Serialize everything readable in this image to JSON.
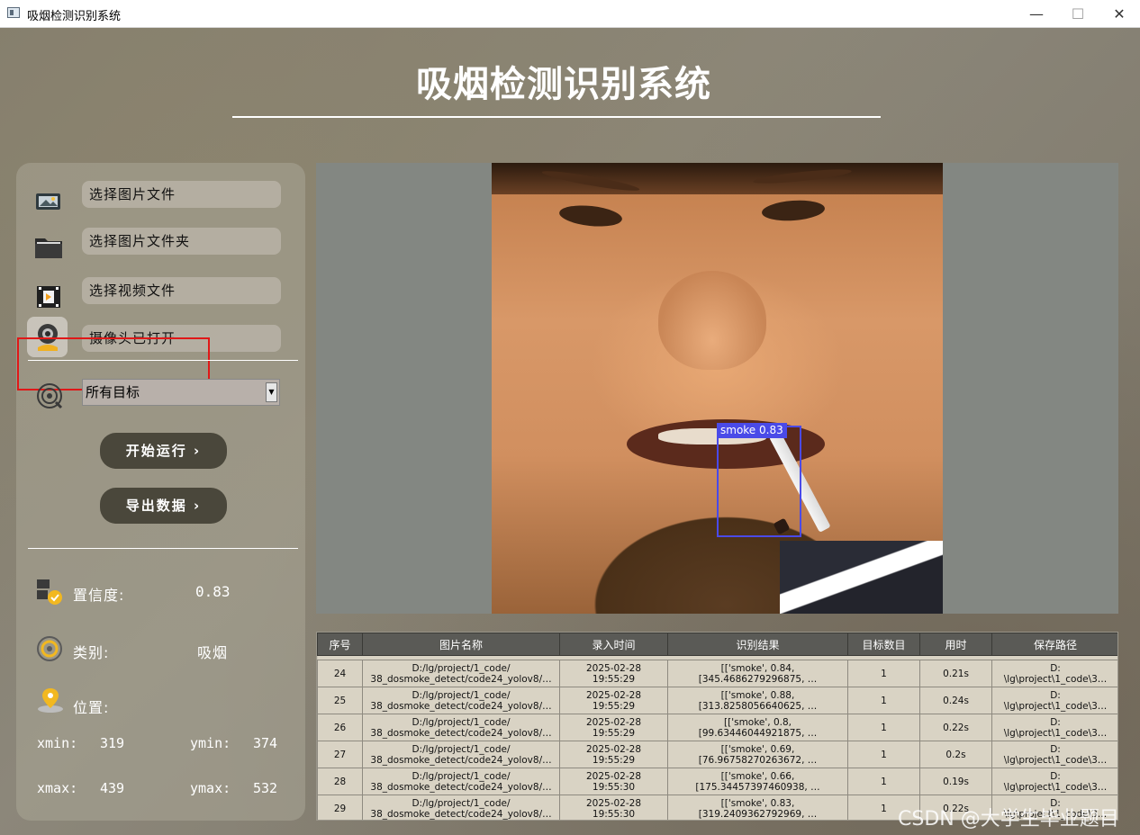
{
  "window": {
    "title": "吸烟检测识别系统",
    "minimize": "—",
    "maximize": "☐",
    "close": "✕"
  },
  "app": {
    "title": "吸烟检测识别系统"
  },
  "menu": {
    "select_image": "选择图片文件",
    "select_folder": "选择图片文件夹",
    "select_video": "选择视频文件",
    "camera": "摄像头已打开"
  },
  "target_select": {
    "value": "所有目标",
    "arrow": "▼"
  },
  "buttons": {
    "start": "开始运行 ›",
    "export": "导出数据 ›"
  },
  "info": {
    "confidence_label": "置信度:",
    "confidence_value": "0.83",
    "class_label": "类别:",
    "class_value": "吸烟",
    "position_label": "位置:",
    "xmin_label": "xmin:",
    "xmin_value": "319",
    "ymin_label": "ymin:",
    "ymin_value": "374",
    "xmax_label": "xmax:",
    "xmax_value": "439",
    "ymax_label": "ymax:",
    "ymax_value": "532"
  },
  "detection": {
    "label": "smoke  0.83",
    "box_color": "#4a4ae8"
  },
  "table": {
    "headers": [
      "序号",
      "图片名称",
      "录入时间",
      "识别结果",
      "目标数目",
      "用时",
      "保存路径"
    ],
    "rows": [
      {
        "idx": "24",
        "name1": "D:/lg/project/1_code/",
        "name2": "38_dosmoke_detect/code24_yolov8/…",
        "t1": "2025-02-28",
        "t2": "19:55:29",
        "r1": "[['smoke', 0.84,",
        "r2": "[345.4686279296875, …",
        "count": "1",
        "time": "0.21s",
        "p1": "D:",
        "p2": "\\lg\\project\\1_code\\3…"
      },
      {
        "idx": "25",
        "name1": "D:/lg/project/1_code/",
        "name2": "38_dosmoke_detect/code24_yolov8/…",
        "t1": "2025-02-28",
        "t2": "19:55:29",
        "r1": "[['smoke', 0.88,",
        "r2": "[313.8258056640625, …",
        "count": "1",
        "time": "0.24s",
        "p1": "D:",
        "p2": "\\lg\\project\\1_code\\3…"
      },
      {
        "idx": "26",
        "name1": "D:/lg/project/1_code/",
        "name2": "38_dosmoke_detect/code24_yolov8/…",
        "t1": "2025-02-28",
        "t2": "19:55:29",
        "r1": "[['smoke', 0.8,",
        "r2": "[99.63446044921875, …",
        "count": "1",
        "time": "0.22s",
        "p1": "D:",
        "p2": "\\lg\\project\\1_code\\3…"
      },
      {
        "idx": "27",
        "name1": "D:/lg/project/1_code/",
        "name2": "38_dosmoke_detect/code24_yolov8/…",
        "t1": "2025-02-28",
        "t2": "19:55:29",
        "r1": "[['smoke', 0.69,",
        "r2": "[76.96758270263672, …",
        "count": "1",
        "time": "0.2s",
        "p1": "D:",
        "p2": "\\lg\\project\\1_code\\3…"
      },
      {
        "idx": "28",
        "name1": "D:/lg/project/1_code/",
        "name2": "38_dosmoke_detect/code24_yolov8/…",
        "t1": "2025-02-28",
        "t2": "19:55:30",
        "r1": "[['smoke', 0.66,",
        "r2": "[175.34457397460938, …",
        "count": "1",
        "time": "0.19s",
        "p1": "D:",
        "p2": "\\lg\\project\\1_code\\3…"
      },
      {
        "idx": "29",
        "name1": "D:/lg/project/1_code/",
        "name2": "38_dosmoke_detect/code24_yolov8/…",
        "t1": "2025-02-28",
        "t2": "19:55:30",
        "r1": "[['smoke', 0.83,",
        "r2": "[319.2409362792969, …",
        "count": "1",
        "time": "0.22s",
        "p1": "D:",
        "p2": "\\lg\\project\\1_code\\3…"
      }
    ]
  },
  "watermark": "CSDN @大学生毕业题目",
  "colors": {
    "highlight_box": "#e01818",
    "button_bg": "#4a473b",
    "table_header": "#5a5a56"
  },
  "icons": [
    "window-app-icon",
    "image-file-icon",
    "folder-icon",
    "video-file-icon",
    "camera-icon",
    "target-icon",
    "confidence-icon",
    "class-icon",
    "location-icon"
  ]
}
